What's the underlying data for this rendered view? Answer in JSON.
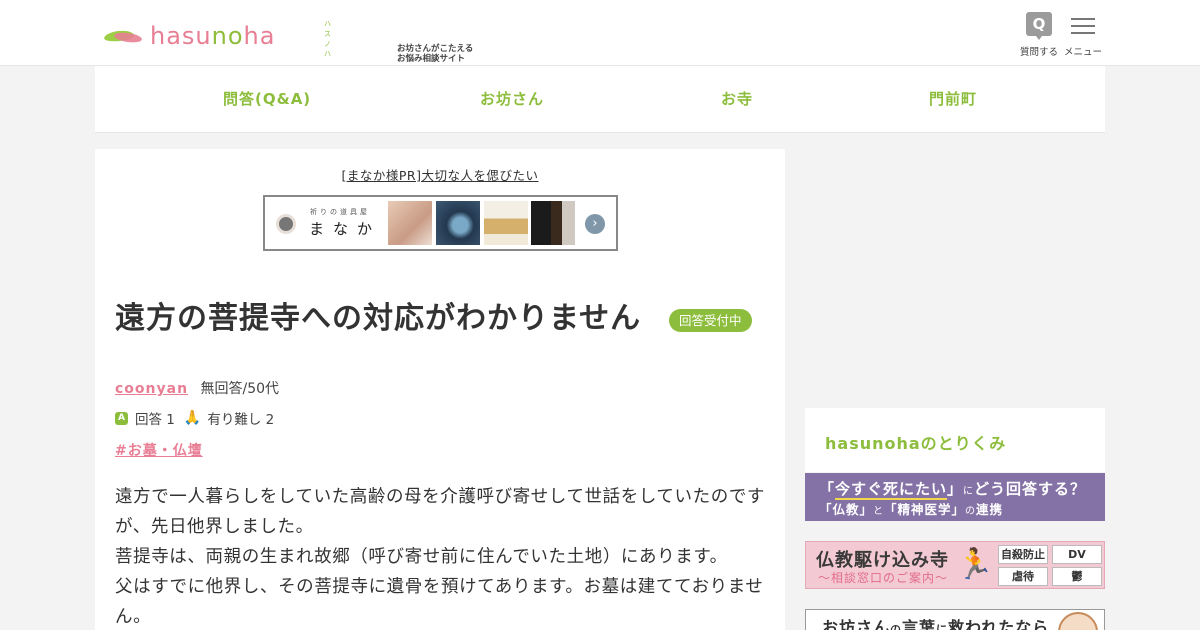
{
  "header": {
    "logo_text_pink": "hasu",
    "logo_text_green": "no",
    "logo_text_pink2": "ha",
    "logo_ruby": "ハスノハ",
    "tagline_line1": "お坊さんがこたえる",
    "tagline_line2": "お悩み相談サイト",
    "question_icon_glyph": "Q",
    "question_label": "質問する",
    "menu_label": "メニュー"
  },
  "nav": {
    "items": [
      {
        "label": "問答(Q&A)"
      },
      {
        "label": "お坊さん"
      },
      {
        "label": "お寺"
      },
      {
        "label": "門前町"
      }
    ]
  },
  "pr": {
    "link_text": "[まなか様PR]大切な人を偲びたい",
    "banner_sub": "祈りの道具屋",
    "banner_brand": "まなか",
    "banner_arrow": "›"
  },
  "question": {
    "title": "遠方の菩提寺への対応がわかりません",
    "status_badge": "回答受付中",
    "author": "coonyan",
    "author_meta": "無回答/50代",
    "answer_icon": "A",
    "answer_count_text": "回答 1",
    "thanks_icon": "🙏",
    "thanks_count_text": "有り難し 2",
    "tag": "#お墓・仏壇",
    "body": [
      "遠方で一人暮らしをしていた高齢の母を介護呼び寄せして世話をしていたのですが、先日他界しました。",
      "菩提寺は、両親の生まれ故郷（呼び寄せ前に住んでいた土地）にあります。",
      "父はすでに他界し、その菩提寺に遺骨を預けてあります。お墓は建てておりません。"
    ]
  },
  "sidebar": {
    "section_title": "hasunohaのとりくみ",
    "banner1_q1": "「",
    "banner1_highlight": "今すぐ死にたい",
    "banner1_q2": "」",
    "banner1_rest_small": "に",
    "banner1_rest": "どう回答する？",
    "banner1_line2_a": "「仏教」",
    "banner1_line2_to": "と",
    "banner1_line2_b": "「精神医学」",
    "banner1_line2_no": "の",
    "banner1_line2_c": "連携",
    "banner2_title": "仏教駆け込み寺",
    "banner2_sub": "〜相談窓口のご案内〜",
    "banner2_chips": [
      "自殺防止",
      "DV",
      "虐待",
      "鬱"
    ],
    "banner3_a": "お坊さん",
    "banner3_no": "の",
    "banner3_b": "言葉",
    "banner3_ni": "に",
    "banner3_c": "救われたなら"
  },
  "colors": {
    "accent_green": "#8dbd3c",
    "accent_pink": "#e87e94",
    "banner_purple": "#8472a6",
    "banner_pink": "#f3c9d3"
  }
}
